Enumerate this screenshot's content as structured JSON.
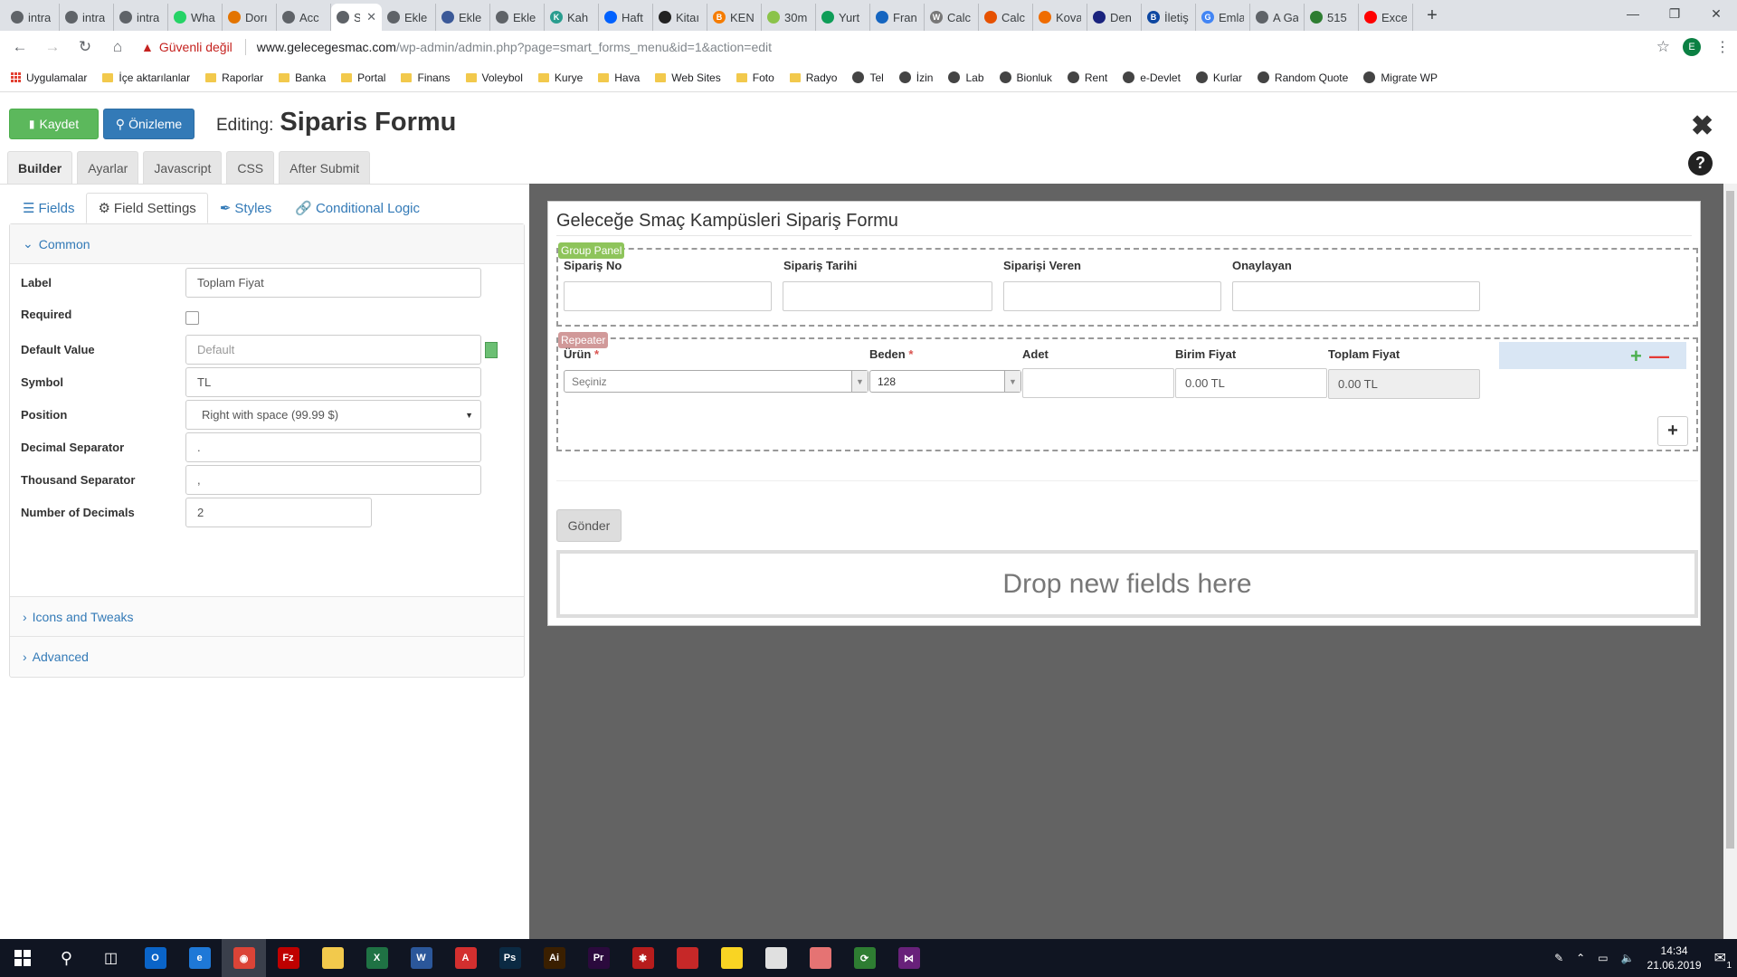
{
  "browser": {
    "tabs": [
      {
        "label": "intra",
        "color": "#5f6368",
        "glyph": ""
      },
      {
        "label": "intra",
        "color": "#5f6368",
        "glyph": ""
      },
      {
        "label": "intra",
        "color": "#5f6368",
        "glyph": ""
      },
      {
        "label": "Wha",
        "color": "#25d366",
        "glyph": ""
      },
      {
        "label": "Dorı",
        "color": "#e37400",
        "glyph": ""
      },
      {
        "label": "Acc",
        "color": "#5f6368",
        "glyph": ""
      },
      {
        "label": "S",
        "color": "#5f6368",
        "glyph": "",
        "active": true
      },
      {
        "label": "Ekle",
        "color": "#5f6368",
        "glyph": ""
      },
      {
        "label": "Ekle",
        "color": "#3b5998",
        "glyph": ""
      },
      {
        "label": "Ekle",
        "color": "#5f6368",
        "glyph": ""
      },
      {
        "label": "Kah",
        "color": "#2a9d8f",
        "glyph": "K"
      },
      {
        "label": "Haft",
        "color": "#0061fe",
        "glyph": ""
      },
      {
        "label": "Kitaı",
        "color": "#222222",
        "glyph": ""
      },
      {
        "label": "KEN",
        "color": "#f57c00",
        "glyph": "B"
      },
      {
        "label": "30m",
        "color": "#8bc34a",
        "glyph": ""
      },
      {
        "label": "Yurt",
        "color": "#0f9d58",
        "glyph": ""
      },
      {
        "label": "Fran",
        "color": "#1565c0",
        "glyph": ""
      },
      {
        "label": "Calc",
        "color": "#777777",
        "glyph": "W"
      },
      {
        "label": "Calc",
        "color": "#e65100",
        "glyph": ""
      },
      {
        "label": "Kova",
        "color": "#ef6c00",
        "glyph": ""
      },
      {
        "label": "Den",
        "color": "#1a237e",
        "glyph": ""
      },
      {
        "label": "İletiş",
        "color": "#0d47a1",
        "glyph": "B"
      },
      {
        "label": "Emla",
        "color": "#4285f4",
        "glyph": "G"
      },
      {
        "label": "A Ga",
        "color": "#5f6368",
        "glyph": ""
      },
      {
        "label": "515",
        "color": "#2e7d32",
        "glyph": ""
      },
      {
        "label": "Exce",
        "color": "#ff0000",
        "glyph": ""
      }
    ],
    "security_label": "Güvenli değil",
    "url_host": "www.gelecegesmac.com",
    "url_path": "/wp-admin/admin.php?page=smart_forms_menu&id=1&action=edit",
    "profile_initial": "E",
    "bookmarks": [
      {
        "label": "Uygulamalar",
        "type": "apps"
      },
      {
        "label": "İçe aktarılanlar",
        "type": "folder"
      },
      {
        "label": "Raporlar",
        "type": "folder"
      },
      {
        "label": "Banka",
        "type": "folder"
      },
      {
        "label": "Portal",
        "type": "folder"
      },
      {
        "label": "Finans",
        "type": "folder"
      },
      {
        "label": "Voleybol",
        "type": "folder"
      },
      {
        "label": "Kurye",
        "type": "folder"
      },
      {
        "label": "Hava",
        "type": "folder"
      },
      {
        "label": "Web Sites",
        "type": "folder"
      },
      {
        "label": "Foto",
        "type": "folder"
      },
      {
        "label": "Radyo",
        "type": "folder"
      },
      {
        "label": "Tel",
        "type": "globe"
      },
      {
        "label": "İzin",
        "type": "globe"
      },
      {
        "label": "Lab",
        "type": "globe"
      },
      {
        "label": "Bionluk",
        "type": "site"
      },
      {
        "label": "Rent",
        "type": "site"
      },
      {
        "label": "e-Devlet",
        "type": "site"
      },
      {
        "label": "Kurlar",
        "type": "site"
      },
      {
        "label": "Random Quote",
        "type": "site"
      },
      {
        "label": "Migrate WP",
        "type": "site"
      }
    ]
  },
  "builder": {
    "save_label": "Kaydet",
    "preview_label": "Önizleme",
    "editing_prefix": "Editing:",
    "form_name": "Siparis Formu",
    "main_tabs": [
      "Builder",
      "Ayarlar",
      "Javascript",
      "CSS",
      "After Submit"
    ],
    "active_main_tab": "Builder"
  },
  "settings_panel": {
    "subtabs": [
      "Fields",
      "Field Settings",
      "Styles",
      "Conditional Logic"
    ],
    "active_subtab": "Field Settings",
    "common_section": "Common",
    "fields": {
      "label": {
        "label": "Label",
        "value": "Toplam Fiyat"
      },
      "required": {
        "label": "Required",
        "checked": false
      },
      "default_value": {
        "label": "Default Value",
        "placeholder": "Default"
      },
      "symbol": {
        "label": "Symbol",
        "value": "TL"
      },
      "position": {
        "label": "Position",
        "value": "Right with space (99.99 $)"
      },
      "decimal_separator": {
        "label": "Decimal Separator",
        "value": "."
      },
      "thousand_separator": {
        "label": "Thousand Separator",
        "value": ","
      },
      "number_of_decimals": {
        "label": "Number of Decimals",
        "value": "2"
      }
    },
    "icons_section": "Icons and Tweaks",
    "advanced_section": "Advanced"
  },
  "form": {
    "title": "Geleceğe Smaç Kampüsleri Sipariş Formu",
    "group_panel_badge": "Group Panel",
    "group_fields": [
      "Sipariş No",
      "Sipariş Tarihi",
      "Siparişi Veren",
      "Onaylayan"
    ],
    "repeater_badge": "Repeater",
    "repeater_columns": {
      "urun": {
        "label": "Ürün",
        "required": true,
        "value": "Seçiniz"
      },
      "beden": {
        "label": "Beden",
        "required": true,
        "value": "128"
      },
      "adet": {
        "label": "Adet",
        "value": ""
      },
      "birim_fiyat": {
        "label": "Birim Fiyat",
        "value": "0.00 TL"
      },
      "toplam_fiyat": {
        "label": "Toplam Fiyat",
        "value": "0.00 TL"
      }
    },
    "required_mark": "*",
    "submit_label": "Gönder",
    "drop_zone": "Drop new fields here"
  },
  "taskbar": {
    "time": "14:34",
    "date": "21.06.2019",
    "notification_count": "1",
    "apps": [
      {
        "name": "outlook-icon",
        "color": "#0a64c8",
        "glyph": "O"
      },
      {
        "name": "edge-icon",
        "color": "#1e78d7",
        "glyph": "e"
      },
      {
        "name": "chrome-icon",
        "color": "#db4437",
        "glyph": "◉",
        "active": true
      },
      {
        "name": "filezilla-icon",
        "color": "#bf0000",
        "glyph": "Fz"
      },
      {
        "name": "file-explorer-icon",
        "color": "#f2c94c",
        "glyph": ""
      },
      {
        "name": "excel-icon",
        "color": "#1f7244",
        "glyph": "X"
      },
      {
        "name": "word-icon",
        "color": "#2b579a",
        "glyph": "W"
      },
      {
        "name": "acrobat-icon",
        "color": "#d32f2f",
        "glyph": "A"
      },
      {
        "name": "photoshop-icon",
        "color": "#0b2a43",
        "glyph": "Ps"
      },
      {
        "name": "illustrator-icon",
        "color": "#3a1f00",
        "glyph": "Ai"
      },
      {
        "name": "premiere-icon",
        "color": "#2b0a3d",
        "glyph": "Pr"
      },
      {
        "name": "red-app-icon",
        "color": "#b71c1c",
        "glyph": "✱"
      },
      {
        "name": "red-app-2-icon",
        "color": "#c62828",
        "glyph": ""
      },
      {
        "name": "sticky-notes-icon",
        "color": "#f9d423",
        "glyph": ""
      },
      {
        "name": "notepad-icon",
        "color": "#e0e0e0",
        "glyph": ""
      },
      {
        "name": "tool-icon",
        "color": "#e57373",
        "glyph": ""
      },
      {
        "name": "sync-icon",
        "color": "#2e7d32",
        "glyph": "⟳"
      },
      {
        "name": "visual-studio-icon",
        "color": "#68217a",
        "glyph": "⋈"
      }
    ]
  }
}
